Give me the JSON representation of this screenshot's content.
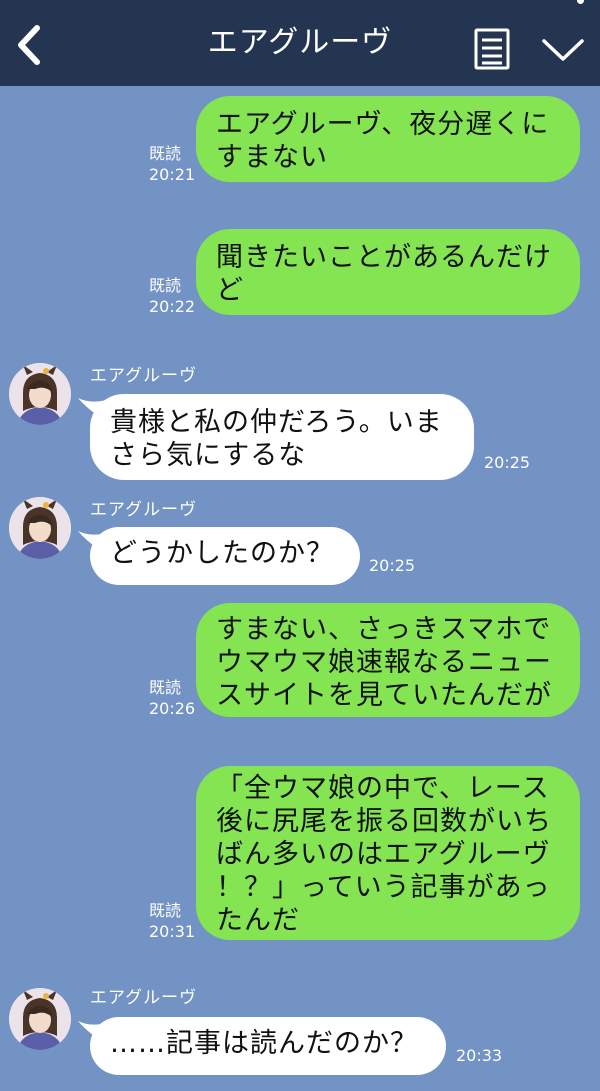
{
  "header": {
    "title": "エアグルーヴ",
    "back_icon": "back-chevron-icon",
    "memo_icon": "memo-icon",
    "menu_icon": "chevron-down-icon",
    "background": "#243552"
  },
  "theme": {
    "chat_background": "#7293c3",
    "outgoing_bubble": "#84e451",
    "incoming_bubble": "#ffffff"
  },
  "messages": [
    {
      "direction": "out",
      "text": "エアグルーヴ、夜分遅くに\nすまない",
      "read": "既読",
      "time": "20:21"
    },
    {
      "direction": "out",
      "text": "聞きたいことがあるんだけ\nど",
      "read": "既読",
      "time": "20:22"
    },
    {
      "direction": "in",
      "sender": "エアグルーヴ",
      "text": "貴様と私の仲だろう。いま\nさら気にするな",
      "time": "20:25"
    },
    {
      "direction": "in",
      "sender": "エアグルーヴ",
      "text": "どうかしたのか？",
      "time": "20:25"
    },
    {
      "direction": "out",
      "text": "すまない、さっきスマホで\nウマウマ娘速報なるニュー\nスサイトを見ていたんだが",
      "read": "既読",
      "time": "20:26"
    },
    {
      "direction": "out",
      "text": "「全ウマ娘の中で、レース\n後に尻尾を振る回数がいち\nばん多いのはエアグルーヴ\n！？」っていう記事があっ\nたんだ",
      "read": "既読",
      "time": "20:31"
    },
    {
      "direction": "in",
      "sender": "エアグルーヴ",
      "text": "……記事は読んだのか？",
      "time": "20:33"
    }
  ]
}
